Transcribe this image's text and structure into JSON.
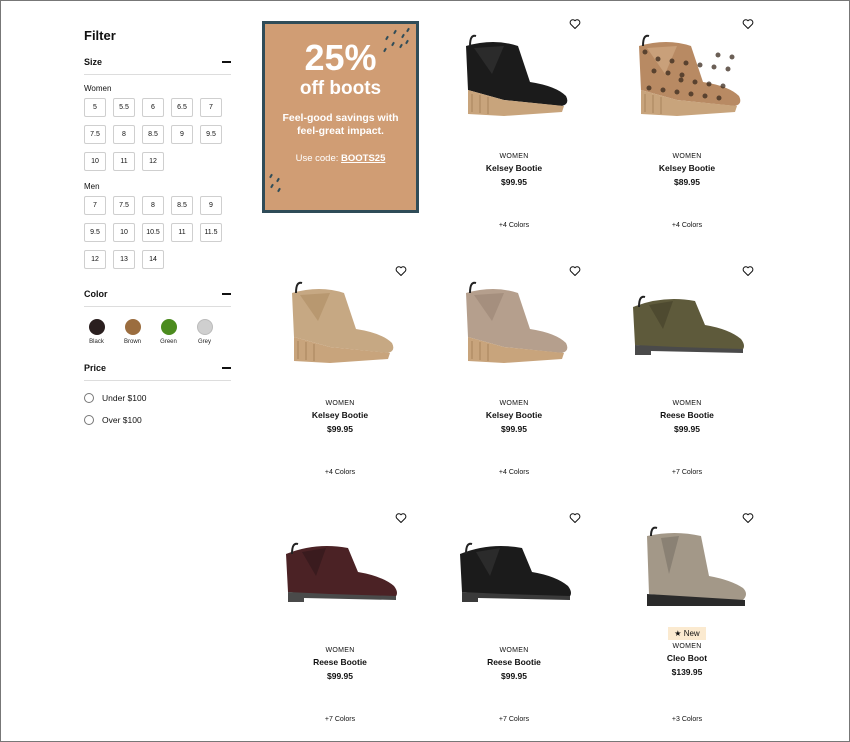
{
  "sidebar": {
    "title": "Filter",
    "size": {
      "label": "Size",
      "women_label": "Women",
      "women": [
        "5",
        "5.5",
        "6",
        "6.5",
        "7",
        "7.5",
        "8",
        "8.5",
        "9",
        "9.5",
        "10",
        "11",
        "12"
      ],
      "men_label": "Men",
      "men": [
        "7",
        "7.5",
        "8",
        "8.5",
        "9",
        "9.5",
        "10",
        "10.5",
        "11",
        "11.5",
        "12",
        "13",
        "14"
      ]
    },
    "color": {
      "label": "Color",
      "options": [
        {
          "name": "Black",
          "hex": "#2a1f1f"
        },
        {
          "name": "Brown",
          "hex": "#9b6d3f"
        },
        {
          "name": "Green",
          "hex": "#4b8b1e"
        },
        {
          "name": "Grey",
          "hex": "#cfcfcf"
        }
      ]
    },
    "price": {
      "label": "Price",
      "options": [
        "Under $100",
        "Over $100"
      ]
    }
  },
  "promo": {
    "headline": "25%",
    "subhead": "off boots",
    "tagline": "Feel-good savings with feel-great impact.",
    "code_prefix": "Use code: ",
    "code": "BOOTS25",
    "bg": "#d09d74",
    "border": "#2f4c58"
  },
  "products": [
    {
      "gender": "WOMEN",
      "name": "Kelsey Bootie",
      "price": "$99.95",
      "colors": "+4 Colors",
      "badge": "",
      "shoe": "black",
      "style": "wedge"
    },
    {
      "gender": "WOMEN",
      "name": "Kelsey Bootie",
      "price": "$89.95",
      "colors": "+4 Colors",
      "badge": "",
      "shoe": "leopard",
      "style": "wedge"
    },
    {
      "gender": "WOMEN",
      "name": "Kelsey Bootie",
      "price": "$99.95",
      "colors": "+4 Colors",
      "badge": "",
      "shoe": "tan",
      "style": "wedge"
    },
    {
      "gender": "WOMEN",
      "name": "Kelsey Bootie",
      "price": "$99.95",
      "colors": "+4 Colors",
      "badge": "",
      "shoe": "taupe",
      "style": "wedge"
    },
    {
      "gender": "WOMEN",
      "name": "Reese Bootie",
      "price": "$99.95",
      "colors": "+7 Colors",
      "badge": "",
      "shoe": "olive",
      "style": "flat"
    },
    {
      "gender": "WOMEN",
      "name": "Reese Bootie",
      "price": "$99.95",
      "colors": "+7 Colors",
      "badge": "",
      "shoe": "burgundy",
      "style": "flat"
    },
    {
      "gender": "WOMEN",
      "name": "Reese Bootie",
      "price": "$99.95",
      "colors": "+7 Colors",
      "badge": "",
      "shoe": "black",
      "style": "flat"
    },
    {
      "gender": "WOMEN",
      "name": "Cleo Boot",
      "price": "$139.95",
      "colors": "+3 Colors",
      "badge": "New",
      "shoe": "stone",
      "style": "chelsea"
    }
  ],
  "icons": {
    "heart": "heart-outline-icon",
    "star": "star-icon",
    "minus": "collapse-icon"
  }
}
